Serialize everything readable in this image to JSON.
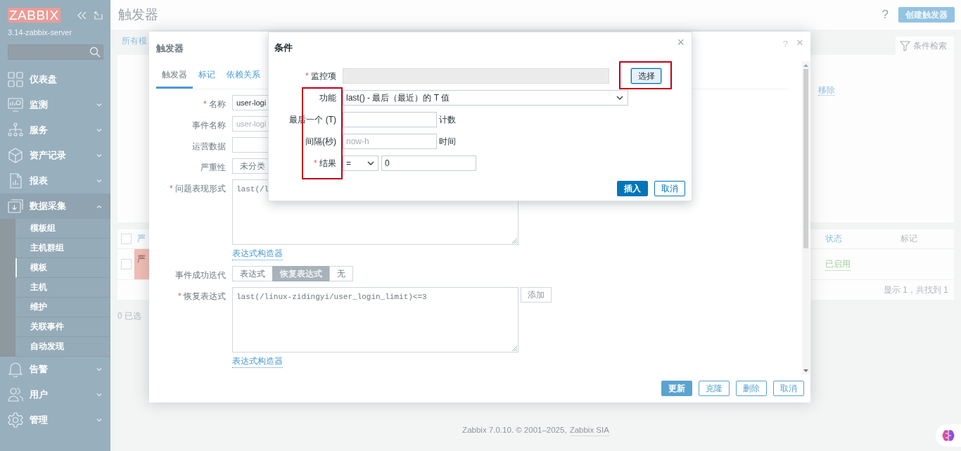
{
  "sidebar": {
    "logo": "ZABBIX",
    "server": "3.14-zabbix-server",
    "menu": [
      {
        "label": "仪表盘",
        "expandable": false,
        "expanded": false
      },
      {
        "label": "监测",
        "expandable": true,
        "expanded": false
      },
      {
        "label": "服务",
        "expandable": true,
        "expanded": false
      },
      {
        "label": "资产记录",
        "expandable": true,
        "expanded": false
      },
      {
        "label": "报表",
        "expandable": true,
        "expanded": false
      },
      {
        "label": "数据采集",
        "expandable": true,
        "expanded": true,
        "children": [
          {
            "label": "模板组",
            "selected": false
          },
          {
            "label": "主机群组",
            "selected": false
          },
          {
            "label": "模板",
            "selected": true
          },
          {
            "label": "主机",
            "selected": false
          },
          {
            "label": "维护",
            "selected": false
          },
          {
            "label": "关联事件",
            "selected": false
          },
          {
            "label": "自动发现",
            "selected": false
          }
        ]
      },
      {
        "label": "告警",
        "expandable": true,
        "expanded": false
      },
      {
        "label": "用户",
        "expandable": true,
        "expanded": false
      },
      {
        "label": "管理",
        "expandable": true,
        "expanded": false
      }
    ]
  },
  "header": {
    "title": "触发器",
    "help": "?",
    "create_button": "创建触发器"
  },
  "background": {
    "breadcrumb": "所有模",
    "filter_tab": "条件检索",
    "remove_link": "移除",
    "table": {
      "columns": [
        "严",
        "状态",
        "标记"
      ],
      "select_all_checked": false,
      "rows": [
        {
          "checked": false,
          "severity": "严",
          "color": "#f1beb4",
          "status": "已启用"
        }
      ],
      "footer": "显示 1，共找到 1"
    },
    "selected_count": "0 已选"
  },
  "trigger_dialog": {
    "title": "触发器",
    "help": "?",
    "close": "×",
    "tabs": [
      {
        "label": "触发器",
        "selected": true
      },
      {
        "label": "标记",
        "selected": false
      },
      {
        "label": "依赖关系",
        "selected": false
      }
    ],
    "fields": [
      {
        "kind": "input",
        "label": "名称",
        "required_mark": "*",
        "value": "user-logi"
      },
      {
        "kind": "input",
        "label": "事件名称",
        "placeholder": "user-logi"
      },
      {
        "kind": "input",
        "label": "运营数据"
      },
      {
        "kind": "segmented",
        "label": "严重性",
        "options": [
          {
            "label": "未分类",
            "selected": false
          }
        ]
      },
      {
        "kind": "textarea",
        "label": "问题表现形式",
        "required_mark": "*",
        "value": "last(/l",
        "link": "表达式构造器"
      },
      {
        "kind": "segmented",
        "label": "事件成功迭代",
        "options": [
          {
            "label": "表达式",
            "selected": false
          },
          {
            "label": "恢复表达式",
            "selected": true
          },
          {
            "label": "无",
            "selected": false
          }
        ]
      },
      {
        "kind": "textarea",
        "label": "恢复表达式",
        "required_mark": "*",
        "value": "last(/linux-zidingyi/user_login_limit)<=3",
        "button": "添加",
        "link": "表达式构造器"
      }
    ],
    "buttons": [
      {
        "label": "更新",
        "primary": true
      },
      {
        "label": "克隆",
        "primary": false
      },
      {
        "label": "删除",
        "primary": false
      },
      {
        "label": "取消",
        "primary": false
      }
    ]
  },
  "condition_dialog": {
    "title": "条件",
    "close": "×",
    "fields": [
      {
        "kind": "picker",
        "label": "监控项",
        "required_mark": "*",
        "button": "选择"
      },
      {
        "kind": "select",
        "label": "功能",
        "value": "last() - 最后（最近）的 T 值"
      },
      {
        "kind": "input",
        "label": "最后一个 (T)",
        "suffix": "计数"
      },
      {
        "kind": "input",
        "label": "间隔(秒)",
        "placeholder": "now-h",
        "suffix": "时间"
      },
      {
        "kind": "result",
        "label": "结果",
        "required_mark": "*",
        "operator": "=",
        "value": "0"
      }
    ],
    "buttons": [
      {
        "label": "插入",
        "primary": true
      },
      {
        "label": "取消",
        "primary": false
      }
    ]
  },
  "footer": {
    "text": "Zabbix 7.0.10. © 2001–2025,",
    "link": "Zabbix SIA"
  }
}
